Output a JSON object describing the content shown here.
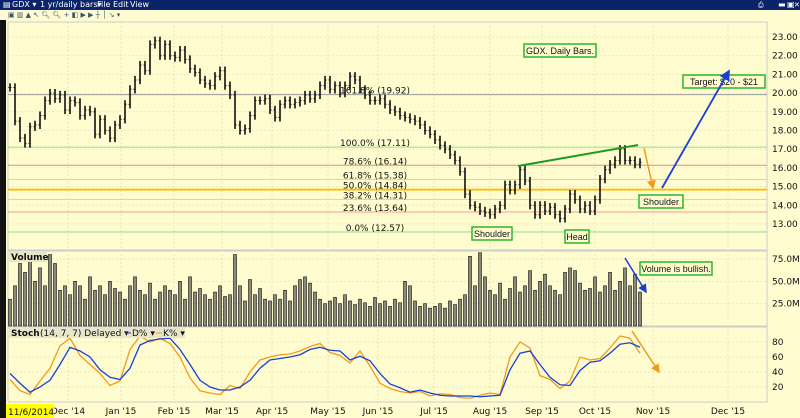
{
  "window": {
    "symbol": "GDX",
    "period": "1 yr/daily bars",
    "menus": [
      "File",
      "Edit",
      "View"
    ]
  },
  "colors": {
    "titlebar": "#0a246a",
    "background": "#fffdd0",
    "dline": "#1a3fd6",
    "kline": "#f39a1a",
    "annotation_border": "#2bb52b"
  },
  "panels": {
    "volume_label": "Volume",
    "stoch_label": "Stoch",
    "stoch_params": "(14, 7, 7) Delayed",
    "stoch_d": "D%",
    "stoch_k": "K%"
  },
  "cursor_date": "11/6/2014",
  "annotations": {
    "title": "GDX. Daily Bars.",
    "target": "Target: $20 - $21",
    "shoulder_right": "Shoulder",
    "shoulder_left": "Shoulder",
    "head": "Head",
    "volume_note": "Volume is bullish."
  },
  "chart_data": [
    {
      "type": "bar",
      "name": "GDX daily price bars (approximate closes)",
      "y_ticks": [
        "23.00",
        "22.00",
        "21.00",
        "20.00",
        "19.00",
        "18.00",
        "17.00",
        "16.00",
        "15.00",
        "14.00",
        "13.00"
      ],
      "ylim": [
        12.3,
        23.8
      ],
      "x_ticks": [
        "Dec '14",
        "Jan '15",
        "Feb '15",
        "Mar '15",
        "Apr '15",
        "May '15",
        "Jun '15",
        "Jul '15",
        "Aug '15",
        "Sep '15",
        "Oct '15",
        "Nov '15",
        "Dec '15"
      ],
      "closes": [
        20.3,
        18.5,
        17.6,
        17.3,
        18.2,
        18.3,
        18.8,
        19.6,
        20.0,
        19.7,
        19.9,
        19.1,
        19.6,
        19.5,
        18.8,
        19.1,
        19.0,
        17.8,
        18.6,
        18.0,
        17.6,
        18.3,
        18.6,
        19.4,
        20.2,
        20.7,
        21.5,
        21.2,
        22.6,
        22.8,
        22.0,
        22.6,
        22.0,
        21.9,
        22.3,
        21.8,
        21.3,
        21.1,
        20.7,
        20.5,
        20.4,
        20.9,
        21.2,
        20.4,
        19.9,
        18.3,
        18.0,
        18.1,
        18.8,
        19.6,
        19.6,
        19.7,
        19.1,
        18.7,
        19.4,
        19.6,
        19.4,
        19.5,
        19.6,
        19.9,
        19.7,
        19.9,
        20.4,
        20.7,
        20.2,
        20.4,
        20.0,
        20.4,
        20.9,
        20.7,
        20.2,
        19.9,
        19.6,
        19.6,
        19.7,
        19.4,
        19.1,
        19.0,
        18.8,
        18.7,
        18.6,
        18.5,
        18.3,
        18.0,
        17.8,
        17.5,
        17.2,
        17.0,
        16.7,
        16.4,
        15.8,
        14.6,
        14.0,
        13.9,
        13.7,
        13.6,
        13.5,
        13.8,
        14.0,
        15.1,
        14.8,
        15.1,
        15.9,
        15.3,
        14.0,
        13.5,
        14.0,
        13.7,
        13.9,
        13.5,
        13.3,
        13.8,
        14.6,
        14.3,
        13.8,
        14.0,
        13.7,
        14.3,
        15.4,
        15.9,
        16.2,
        16.4,
        17.0,
        16.4,
        16.4,
        16.2,
        16.3
      ],
      "fib_levels": [
        {
          "label": "161.8% (19.92)",
          "value": 19.92,
          "color": "#9a9a9a"
        },
        {
          "label": "100.0% (17.11)",
          "value": 17.11,
          "color": "#8be08b"
        },
        {
          "label": "78.6% (16.14)",
          "value": 16.14,
          "color": "#e88a7a"
        },
        {
          "label": "61.8% (15.38)",
          "value": 15.38,
          "color": "#8ff0e8"
        },
        {
          "label": "50.0% (14.84)",
          "value": 14.84,
          "color": "#f5c018"
        },
        {
          "label": "38.2% (14.31)",
          "value": 14.31,
          "color": "#8ff0e8"
        },
        {
          "label": "23.6% (13.64)",
          "value": 13.64,
          "color": "#f0a090"
        },
        {
          "label": "0.0% (12.57)",
          "value": 12.57,
          "color": "#8be08b"
        }
      ]
    },
    {
      "type": "bar",
      "name": "Volume",
      "y_ticks": [
        "75.0M",
        "50.0M",
        "25.0M"
      ],
      "values_millions": [
        30,
        45,
        70,
        60,
        75,
        50,
        65,
        45,
        80,
        70,
        40,
        45,
        35,
        50,
        45,
        30,
        55,
        40,
        45,
        35,
        50,
        42,
        38,
        30,
        45,
        55,
        40,
        35,
        48,
        30,
        38,
        45,
        40,
        35,
        50,
        30,
        55,
        38,
        42,
        35,
        30,
        38,
        45,
        33,
        35,
        80,
        45,
        28,
        52,
        35,
        42,
        30,
        28,
        35,
        30,
        40,
        28,
        45,
        52,
        55,
        48,
        38,
        30,
        25,
        28,
        32,
        25,
        35,
        28,
        24,
        30,
        26,
        22,
        32,
        25,
        28,
        22,
        30,
        26,
        50,
        45,
        28,
        22,
        25,
        20,
        22,
        25,
        20,
        28,
        24,
        30,
        35,
        78,
        45,
        82,
        55,
        40,
        35,
        48,
        30,
        42,
        55,
        38,
        45,
        62,
        40,
        50,
        58,
        45,
        40,
        35,
        60,
        65,
        62,
        48,
        40,
        42,
        55,
        38,
        45,
        60,
        40,
        50,
        65,
        45,
        58,
        38
      ]
    },
    {
      "type": "line",
      "name": "Stoch (14, 7, 7) Delayed",
      "y_ticks": [
        "80",
        "60",
        "40",
        "20"
      ],
      "ylim": [
        0,
        100
      ],
      "series": [
        {
          "name": "D%",
          "values": [
            38,
            25,
            13,
            20,
            29,
            50,
            73,
            68,
            60,
            43,
            33,
            30,
            45,
            76,
            82,
            84,
            85,
            70,
            50,
            29,
            20,
            16,
            16,
            20,
            29,
            45,
            56,
            58,
            60,
            63,
            70,
            73,
            69,
            68,
            56,
            61,
            55,
            38,
            24,
            19,
            13,
            16,
            12,
            9,
            8,
            8,
            8,
            7,
            8,
            9,
            43,
            65,
            68,
            50,
            33,
            23,
            22,
            42,
            53,
            55,
            65,
            77,
            79,
            73
          ]
        },
        {
          "name": "K%",
          "values": [
            30,
            15,
            10,
            28,
            45,
            75,
            85,
            62,
            50,
            38,
            22,
            28,
            70,
            88,
            80,
            85,
            78,
            60,
            32,
            15,
            12,
            10,
            22,
            18,
            40,
            56,
            60,
            63,
            64,
            68,
            74,
            78,
            66,
            62,
            52,
            68,
            48,
            25,
            18,
            14,
            12,
            14,
            8,
            11,
            10,
            6,
            5,
            9,
            12,
            10,
            60,
            80,
            72,
            35,
            30,
            18,
            28,
            60,
            56,
            58,
            72,
            88,
            85,
            65
          ]
        }
      ]
    }
  ]
}
